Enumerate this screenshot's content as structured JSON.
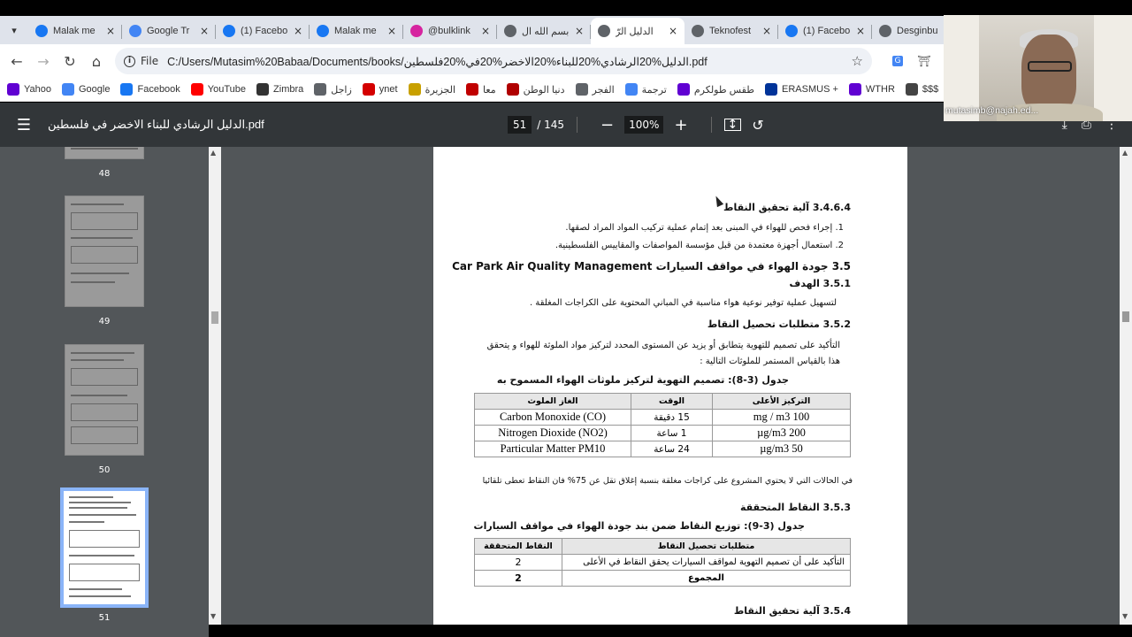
{
  "tabs": [
    {
      "title": "Malak me",
      "icon": "facebook-icon",
      "color": "#1877f2"
    },
    {
      "title": "Google Tr",
      "icon": "google-translate-icon",
      "color": "#4285f4"
    },
    {
      "title": "(1) Facebo",
      "icon": "facebook-icon",
      "color": "#1877f2"
    },
    {
      "title": "Malak me",
      "icon": "facebook-icon",
      "color": "#1877f2"
    },
    {
      "title": "@bulklink",
      "icon": "instagram-icon",
      "color": "#d6249f"
    },
    {
      "title": "بسم الله ال",
      "icon": "globe-icon",
      "color": "#5f6368"
    },
    {
      "title": "الدليل الرّ",
      "icon": "globe-icon",
      "color": "#5f6368",
      "active": true
    },
    {
      "title": "Teknofest",
      "icon": "globe-icon",
      "color": "#5f6368"
    },
    {
      "title": "(1) Facebo",
      "icon": "facebook-icon",
      "color": "#1877f2"
    },
    {
      "title": "Desginbu",
      "icon": "globe-icon",
      "color": "#5f6368"
    }
  ],
  "address": {
    "scheme_label": "File",
    "url": "C:/Users/Mutasim%20Babaa/Documents/books/الدليل%20الرشادي%20للبناء%20الاخضر%20في%20فلسطين.pdf"
  },
  "bookmarks": [
    {
      "label": "Yahoo",
      "icon": "yahoo-icon",
      "color": "#6001d2"
    },
    {
      "label": "Google",
      "icon": "google-icon",
      "color": "#4285f4"
    },
    {
      "label": "Facebook",
      "icon": "facebook-icon",
      "color": "#1877f2"
    },
    {
      "label": "YouTube",
      "icon": "youtube-icon",
      "color": "#ff0000"
    },
    {
      "label": "Zimbra",
      "icon": "zimbra-icon",
      "color": "#333333"
    },
    {
      "label": "زاجل",
      "icon": "globe-icon",
      "color": "#5f6368"
    },
    {
      "label": "ynet",
      "icon": "ynet-icon",
      "color": "#d40000"
    },
    {
      "label": "الجزيرة",
      "icon": "aljazeera-icon",
      "color": "#c8a000"
    },
    {
      "label": "معا",
      "icon": "maan-icon",
      "color": "#c00000"
    },
    {
      "label": "دنيا الوطن",
      "icon": "dunya-icon",
      "color": "#b00000"
    },
    {
      "label": "الفجر",
      "icon": "globe-icon",
      "color": "#5f6368"
    },
    {
      "label": "ترجمة",
      "icon": "translate-icon",
      "color": "#4285f4"
    },
    {
      "label": "طقس طولكرم",
      "icon": "yahoo-icon",
      "color": "#6001d2"
    },
    {
      "label": "ERASMUS +",
      "icon": "erasmus-icon",
      "color": "#003399"
    },
    {
      "label": "WTHR",
      "icon": "yahoo-icon",
      "color": "#6001d2"
    },
    {
      "label": "$$$",
      "icon": "xe-icon",
      "color": "#444444"
    }
  ],
  "pdf": {
    "title": "الدليل الرشادي للبناء الاخضر في فلسطين.pdf",
    "current_page": "51",
    "total_pages": "/ 145",
    "zoom": "100%"
  },
  "thumbnails": [
    {
      "label": "48"
    },
    {
      "label": "49"
    },
    {
      "label": "50"
    },
    {
      "label": "51",
      "selected": true
    }
  ],
  "page": {
    "s3464": "3.4.6.4  آلية تحقيق النقاط",
    "s3464_items": [
      "1.  إجراء فحص للهواء في المبنى بعد إتمام عملية تركيب المواد المراد لصقها.",
      "2.  استعمال أجهزة معتمدة من قبل مؤسسة المواصفات والمقاييس الفلسطينية."
    ],
    "s35": "3.5  جودة الهواء في مواقف السيارات Car Park Air Quality Management",
    "s351": "3.5.1  الهدف",
    "s351_text": "لتسهيل عملية توفير نوعية هواء مناسبة في المباني المحتوية على الكراجات المغلقة .",
    "s352": "3.5.2  متطلبات تحصيل النقاط",
    "s352_text": "التأكيد على تصميم للتهوية يتطابق أو يزيد عن المستوى المحدد لتركيز مواد الملوثة للهواء و يتحقق هذا بالقياس المستمر للملوثات التالية :",
    "table1_caption": "جدول (3-8): تصميم التهوية لتركيز ملوثات الهواء المسموح به",
    "table1_headers": [
      "الغاز الملوث",
      "الوقت",
      "التركيز الأعلى"
    ],
    "table1_rows": [
      [
        "Carbon Monoxide (CO)",
        "15 دقيقة",
        "100 mg / m3"
      ],
      [
        "Nitrogen Dioxide (NO2)",
        "1 ساعة",
        "200 µg/m3"
      ],
      [
        "Particular Matter PM10",
        "24 ساعة",
        "50 µg/m3"
      ]
    ],
    "note": "في الحالات التي لا يحتوي المشروع على كراجات مغلقة بنسبة إغلاق تقل عن 75% فان النقاط تعطى تلقائيا",
    "s353": "3.5.3  النقاط المتحققة",
    "table2_caption": "جدول (3-9): توزيع النقاط ضمن بند جودة الهواء في مواقف السيارات",
    "table2_headers": [
      "متطلبات تحصيل النقاط",
      "النقاط المتحققة"
    ],
    "table2_rows": [
      [
        "التأكيد على أن تصميم التهوية لمواقف السيارات يحقق النقاط في الأعلى",
        "2"
      ],
      [
        "المجموع",
        "2"
      ]
    ],
    "s354": "3.5.4  آلية تحقيق النقاط"
  },
  "webcam": {
    "name": "mutasimb@najah.ed..."
  }
}
